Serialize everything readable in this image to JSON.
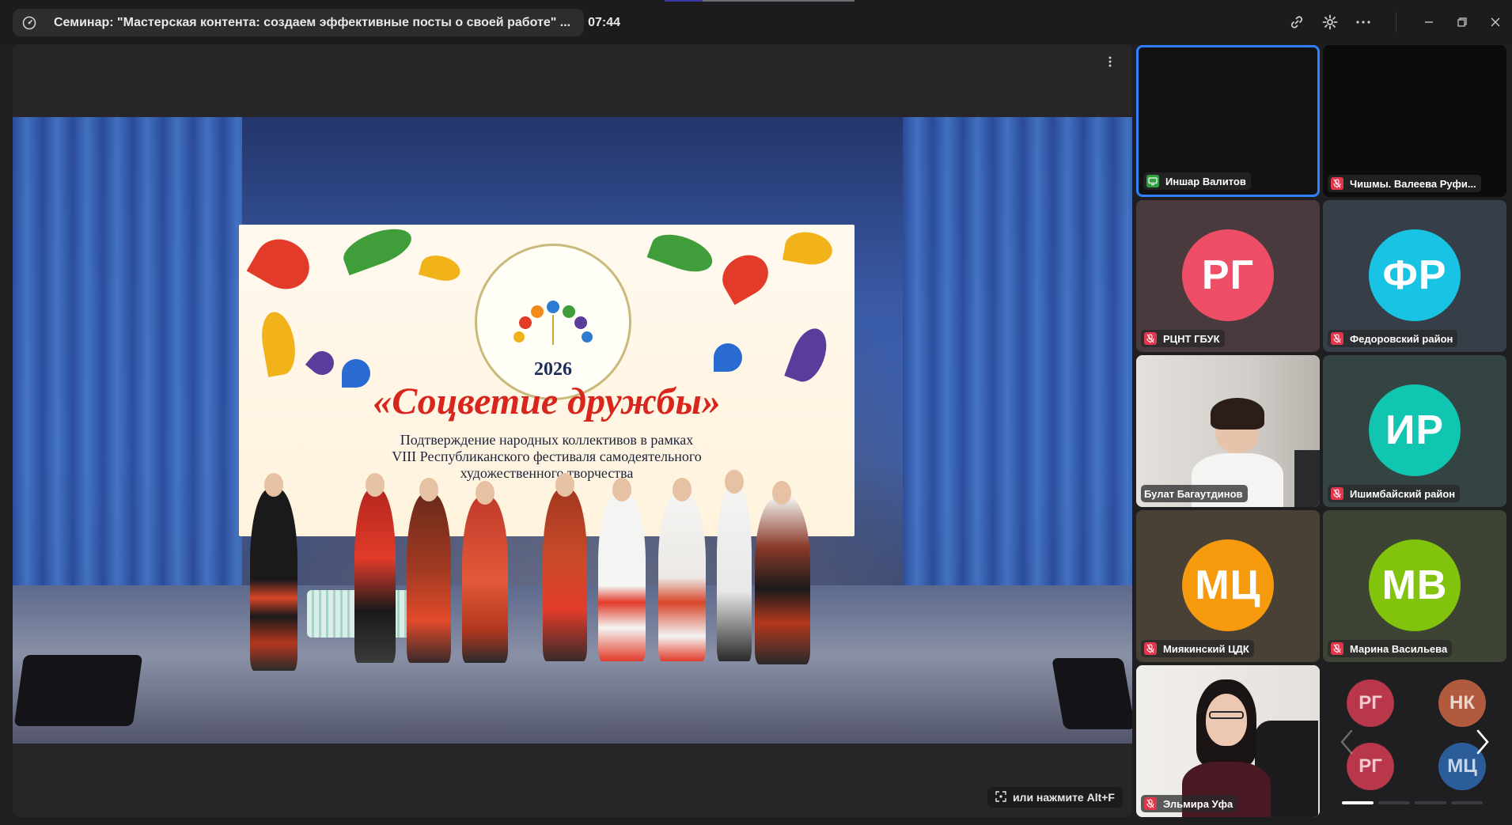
{
  "header": {
    "title": "Семинар: \"Мастерская контента: создаем эффективные посты о своей работе\" ...",
    "timer": "07:44",
    "icons": [
      "speed-icon",
      "link-icon",
      "gear-icon",
      "more-icon",
      "minimize-icon",
      "restore-icon",
      "close-icon"
    ]
  },
  "stage": {
    "festival_year": "2026",
    "festival_title": "«Соцветие дружбы»",
    "festival_subtitle": "Подтверждение народных коллективов в рамках\nVIII Республиканского фестиваля самодеятельного\nхудожественного творчества",
    "fullscreen_hint": "или нажмите Alt+F"
  },
  "participants": [
    {
      "name": "Иншар Валитов",
      "initials": "",
      "status": "sharing-screen",
      "active": true
    },
    {
      "name": "Чишмы. Валеева Руфи...",
      "initials": "",
      "status": "muted"
    },
    {
      "name": "РЦНТ ГБУК",
      "initials": "РГ",
      "color": "#ef4f66",
      "bg": "#4a3a3e",
      "status": "muted"
    },
    {
      "name": "Федоровский район",
      "initials": "ФР",
      "color": "#19c3e3",
      "bg": "#363f48",
      "status": "muted"
    },
    {
      "name": "Булат Багаутдинов",
      "initials": "",
      "status": "camera"
    },
    {
      "name": "Ишимбайский район",
      "initials": "ИР",
      "color": "#10c6b0",
      "bg": "#344443",
      "status": "muted"
    },
    {
      "name": "Миякинский ЦДК",
      "initials": "МЦ",
      "color": "#f79a0e",
      "bg": "#4a4136",
      "status": "muted"
    },
    {
      "name": "Марина Васильева",
      "initials": "МВ",
      "color": "#82c30d",
      "bg": "#3e4433",
      "status": "muted"
    },
    {
      "name": "Эльмира Уфа",
      "initials": "",
      "status": "camera-muted"
    }
  ],
  "more_participants": [
    {
      "initials": "РГ",
      "color": "#b8374a"
    },
    {
      "initials": "НК",
      "color": "#b25a3e"
    },
    {
      "initials": "РГ",
      "color": "#b8374a"
    },
    {
      "initials": "МЦ",
      "color": "#2a5d9a"
    }
  ]
}
